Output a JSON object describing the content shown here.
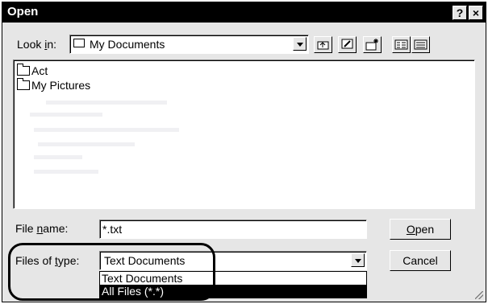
{
  "window": {
    "title": "Open",
    "help_button": "?",
    "close_button": "×"
  },
  "look_in": {
    "label_prefix": "Look ",
    "label_underlined": "i",
    "label_suffix": "n:",
    "value": "My Documents"
  },
  "toolbar": {
    "up_one_level": "up-folder-icon",
    "desktop": "desktop-icon",
    "new_folder": "new-folder-icon",
    "list_view": "list-view-icon",
    "details_view": "details-view-icon"
  },
  "file_list": {
    "items": [
      {
        "name": "Act",
        "icon": "folder-icon"
      },
      {
        "name": "My Pictures",
        "icon": "folder-icon"
      }
    ]
  },
  "file_name": {
    "label_prefix": "File ",
    "label_underlined": "n",
    "label_suffix": "ame:",
    "value": "*.txt"
  },
  "file_type": {
    "label_prefix": "Files of ",
    "label_underlined": "t",
    "label_suffix": "ype:",
    "value": "Text Documents",
    "options": [
      "Text Documents",
      "All Files (*.*)"
    ],
    "highlighted_index": 1
  },
  "buttons": {
    "open_underlined": "O",
    "open_rest": "pen",
    "cancel": "Cancel"
  },
  "colors": {
    "titlebar": "#000000",
    "dialog_face": "#e6e6e6",
    "highlight": "#000000"
  }
}
